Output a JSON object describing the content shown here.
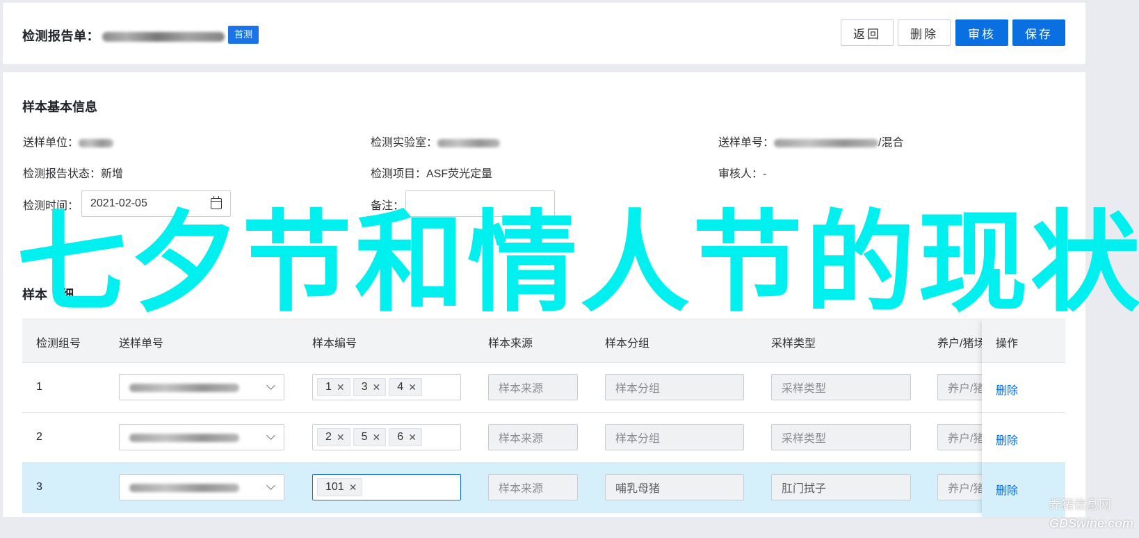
{
  "header": {
    "title": "检测报告单：",
    "badge": "首测",
    "buttons": {
      "back": "返回",
      "delete": "删除",
      "review": "审核",
      "save": "保存"
    }
  },
  "basic_info": {
    "section_title": "样本基本信息",
    "fields": {
      "sender_unit_label": "送样单位：",
      "lab_label": "检测实验室：",
      "sample_no_label": "送样单号：",
      "sample_no_suffix": "/混合",
      "report_status_label": "检测报告状态：",
      "report_status_value": "新增",
      "project_label": "检测项目：",
      "project_value": "ASF荧光定量",
      "reviewer_label": "审核人：",
      "reviewer_value": "-",
      "time_label": "检测时间：",
      "time_value": "2021-02-05",
      "remark_label": "备注："
    }
  },
  "detail": {
    "section_title": "样本",
    "section_title_tail": "细",
    "columns": [
      "检测组号",
      "送样单号",
      "样本编号",
      "样本来源",
      "样本分组",
      "采样类型",
      "养户/猪场",
      "操作"
    ],
    "rows": [
      {
        "group": "1",
        "tags": [
          "1",
          "3",
          "4"
        ],
        "source_placeholder": "样本来源",
        "group_placeholder": "样本分组",
        "type_placeholder": "采样类型",
        "farm": "养户/猪",
        "action": "删除"
      },
      {
        "group": "2",
        "tags": [
          "2",
          "5",
          "6"
        ],
        "source_placeholder": "样本来源",
        "group_placeholder": "样本分组",
        "type_placeholder": "采样类型",
        "farm": "养户/猪",
        "action": "删除"
      },
      {
        "group": "3",
        "tags": [
          "101"
        ],
        "source_placeholder": "样本来源",
        "group_value": "哺乳母猪",
        "type_value": "肛门拭子",
        "farm": "养户/猪",
        "action": "删除"
      }
    ]
  },
  "overlay": {
    "text": "七夕节和情人节的现状"
  },
  "watermark": {
    "cn": "养猪信息网",
    "en": "GDSwine.com"
  },
  "colors": {
    "primary": "#0a6fe0",
    "overlay": "#00f0f0",
    "selected_row": "#d6f0fb"
  }
}
